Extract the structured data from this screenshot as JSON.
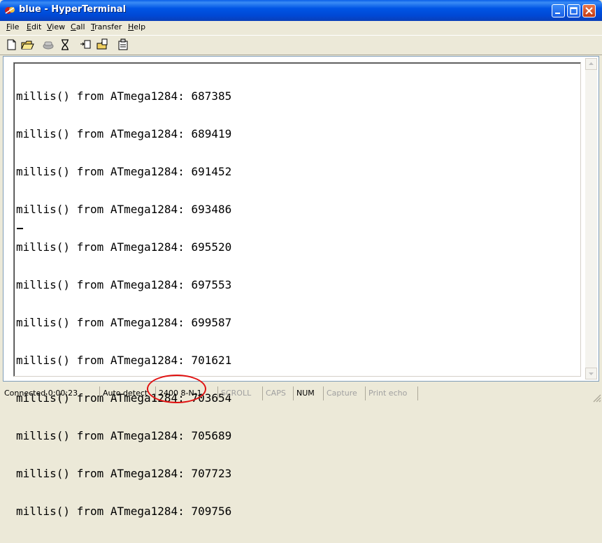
{
  "window": {
    "title": "blue - HyperTerminal",
    "icon": "hyperterminal-app-icon"
  },
  "menu": [
    {
      "label": "File",
      "key": "F",
      "rest": "ile"
    },
    {
      "label": "Edit",
      "key": "E",
      "rest": "dit"
    },
    {
      "label": "View",
      "key": "V",
      "rest": "iew"
    },
    {
      "label": "Call",
      "key": "C",
      "rest": "all"
    },
    {
      "label": "Transfer",
      "key": "T",
      "rest": "ransfer"
    },
    {
      "label": "Help",
      "key": "H",
      "rest": "elp"
    }
  ],
  "toolbar": {
    "icons": [
      "new-icon",
      "open-icon",
      "dial-icon",
      "disconnect-icon",
      "send-icon",
      "receive-icon",
      "properties-icon"
    ]
  },
  "terminal": {
    "lines": [
      "millis() from ATmega1284: 687385",
      "millis() from ATmega1284: 689419",
      "millis() from ATmega1284: 691452",
      "millis() from ATmega1284: 693486",
      "millis() from ATmega1284: 695520",
      "millis() from ATmega1284: 697553",
      "millis() from ATmega1284: 699587",
      "millis() from ATmega1284: 701621",
      "millis() from ATmega1284: 703654",
      "millis() from ATmega1284: 705689",
      "millis() from ATmega1284: 707723",
      "millis() from ATmega1284: 709756"
    ]
  },
  "status": {
    "connected": "Connected 0:00:23",
    "detect": "Auto detect",
    "port_settings": "2400 8-N-1",
    "scroll": "SCROLL",
    "caps": "CAPS",
    "num": "NUM",
    "capture": "Capture",
    "print_echo": "Print echo"
  },
  "colors": {
    "title_bar": "#0055e5",
    "highlight_ring": "#e01010",
    "window_bg": "#ece9d8"
  }
}
